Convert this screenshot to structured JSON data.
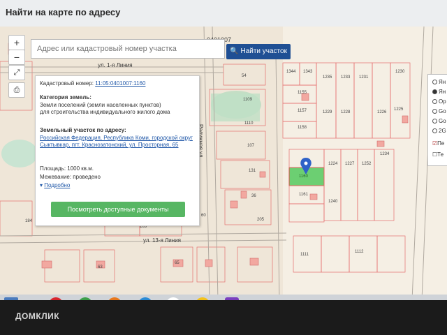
{
  "window": {
    "title": "Найти на карте по адресу"
  },
  "search": {
    "placeholder": "Адрес или кадастровый номер участка",
    "button_label": "Найти участок"
  },
  "controls": {
    "zoom_in": "+",
    "zoom_out": "−"
  },
  "map": {
    "top_label": "0401007",
    "streets": [
      "ул. 1-я Линия",
      "Радужная ул.",
      "ул. 13-я Линия"
    ],
    "parcel_labels": [
      "1344",
      "1343",
      "1235",
      "1233",
      "1231",
      "1230",
      "1155",
      "1157",
      "1158",
      "1229",
      "1228",
      "1226",
      "1225",
      "1161",
      "1160",
      "1224",
      "1227",
      "1252",
      "1234",
      "1240",
      "54",
      "1109",
      "1110",
      "107",
      "131",
      "36",
      "60",
      "205",
      "63",
      "65",
      "1111",
      "1112",
      "184",
      "103"
    ]
  },
  "popup": {
    "cadastral_label": "Кадастровый номер:",
    "cadastral_number": "11:05:0401007:1160",
    "category_label": "Категория земель:",
    "category_value": "Земли поселений (земли населенных пунктов)",
    "category_use": "для строительства индивидуального жилого дома",
    "address_label": "Земельный участок по адресу:",
    "address_value": "Российская Федерация, Республика Коми, городской округ Сыктывкар, пгт. Краснозатонский, ул. Просторная, 65",
    "area": "Площадь: 1000 кв.м.",
    "survey": "Межевание: проведено",
    "details_link": "Подробно",
    "documents_button": "Посмотреть доступные документы"
  },
  "layers": {
    "options": [
      "Ян",
      "Ян",
      "Op",
      "Go",
      "Go",
      "2G"
    ],
    "checkbox_label": "Пе",
    "checkbox2_label": "Те"
  },
  "watermark": "ДОМКЛИК",
  "accent_colors": {
    "search_button": "#1f4f94",
    "docs_button": "#57b663",
    "parcel_highlight": "#6ccf72",
    "marker": "#2f62c8"
  }
}
